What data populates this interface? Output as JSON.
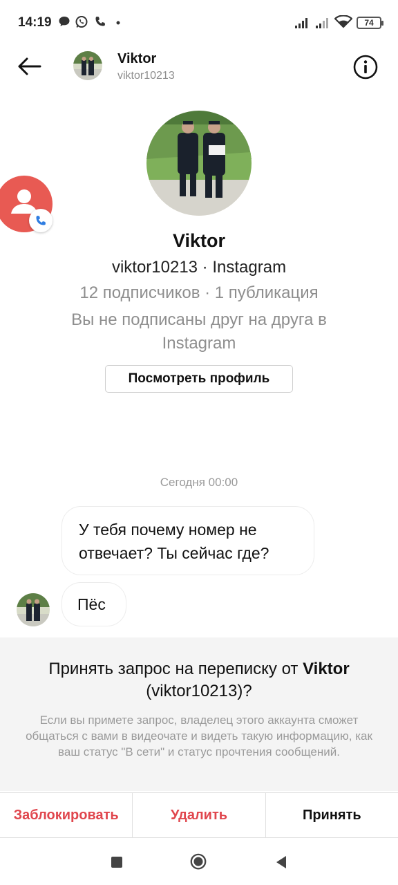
{
  "status_bar": {
    "time": "14:19",
    "battery": "74",
    "left_icons": [
      "chat-icon",
      "whatsapp-icon",
      "phone-icon",
      "dot-icon"
    ],
    "right_icons": [
      "signal-icon",
      "signal-icon",
      "wifi-icon",
      "battery-icon"
    ]
  },
  "header": {
    "name": "Viktor",
    "username": "viktor10213"
  },
  "profile": {
    "name": "Viktor",
    "handle": "viktor10213 · Instagram",
    "stats": "12 подписчиков · 1 публикация",
    "follow_status": "Вы не подписаны друг на друга в Instagram",
    "view_profile_label": "Посмотреть профиль"
  },
  "chat": {
    "timestamp": "Сегодня 00:00",
    "messages": [
      {
        "text": "У тебя почему номер не отвечает? Ты сейчас где?"
      },
      {
        "text": "Пёс"
      }
    ]
  },
  "request": {
    "title": "Принять запрос на переписку от ",
    "title_name": "Viktor",
    "title_handle": "(viktor10213)",
    "title_suffix": "?",
    "description": "Если вы примете запрос, владелец этого аккаунта сможет общаться с вами в видеочате и видеть такую информацию, как ваш статус \"В сети\" и статус прочтения сообщений."
  },
  "actions": {
    "block": "Заблокировать",
    "delete": "Удалить",
    "accept": "Принять"
  },
  "colors": {
    "danger": "#e0464d",
    "call_bubble": "#e85a53",
    "muted_text": "#8e8e8e",
    "panel_bg": "#f4f4f4"
  }
}
